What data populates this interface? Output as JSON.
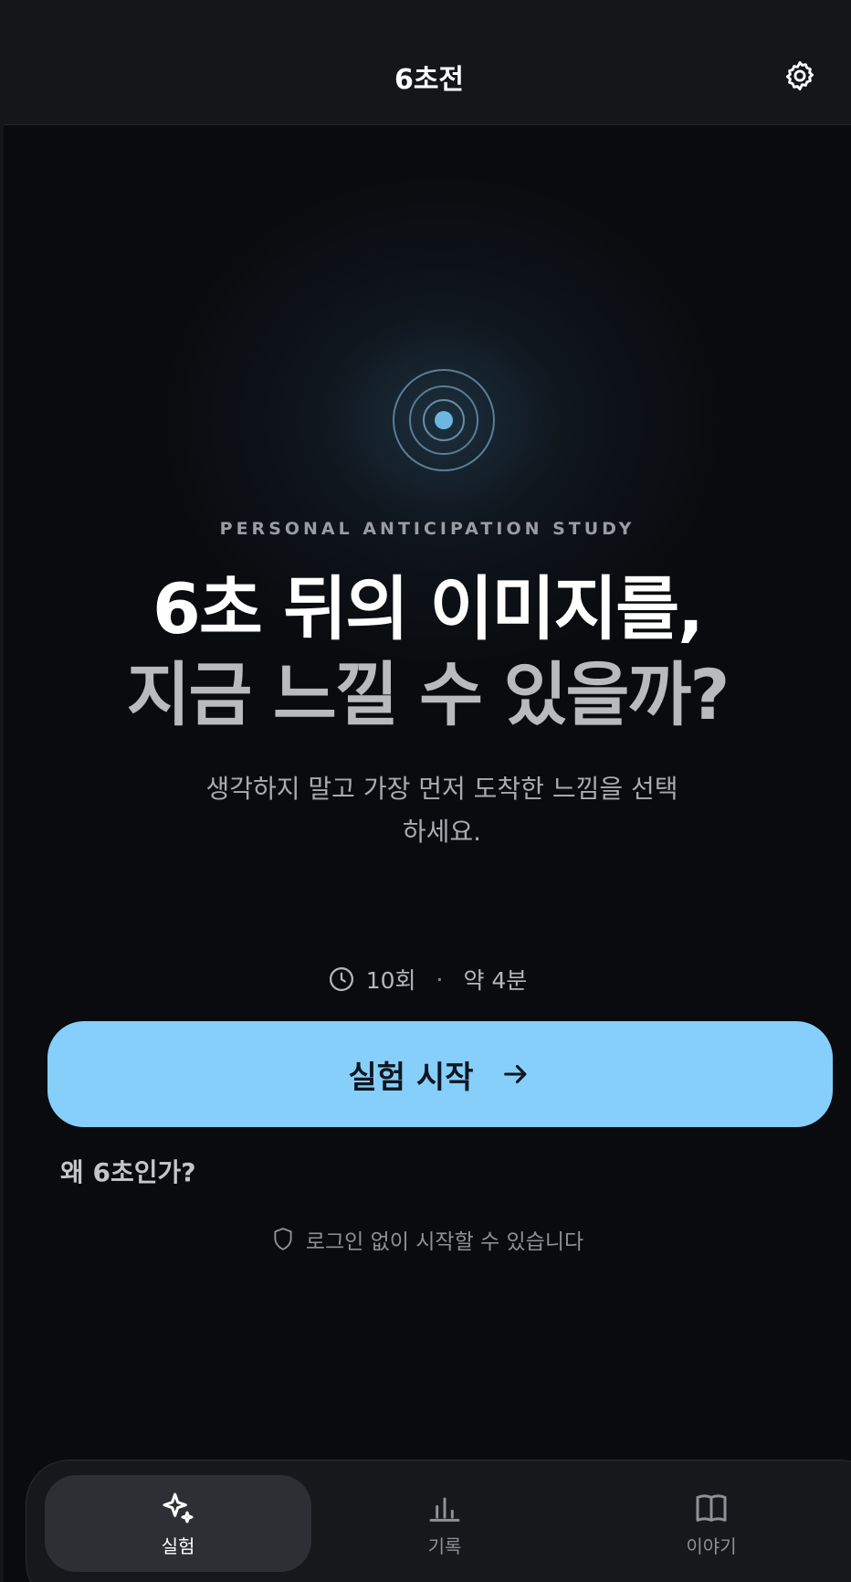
{
  "header": {
    "title": "6초전",
    "settings_icon": "gear-icon"
  },
  "hero": {
    "icon": "radar-icon",
    "kicker": "PERSONAL ANTICIPATION STUDY",
    "headline_line1": "6초 뒤의 이미지를,",
    "headline_line2": "지금 느낄 수 있을까?",
    "subtitle": "생각하지 말고 가장 먼저 도착한 느낌을 선택하세요."
  },
  "meta": {
    "icon": "clock-icon",
    "rounds": "10회",
    "separator": "·",
    "duration": "약 4분"
  },
  "cta": {
    "label": "실험 시작",
    "icon": "arrow-right-icon"
  },
  "why_link": "왜 6초인가?",
  "note": {
    "icon": "shield-icon",
    "text": "로그인 없이 시작할 수 있습니다"
  },
  "nav": {
    "items": [
      {
        "label": "실험",
        "icon": "sparkle-icon",
        "active": true
      },
      {
        "label": "기록",
        "icon": "bar-chart-icon",
        "active": false
      },
      {
        "label": "이야기",
        "icon": "book-icon",
        "active": false
      }
    ]
  },
  "colors": {
    "accent": "#86cffa",
    "background": "#0a0b0e",
    "header": "#15161a"
  }
}
